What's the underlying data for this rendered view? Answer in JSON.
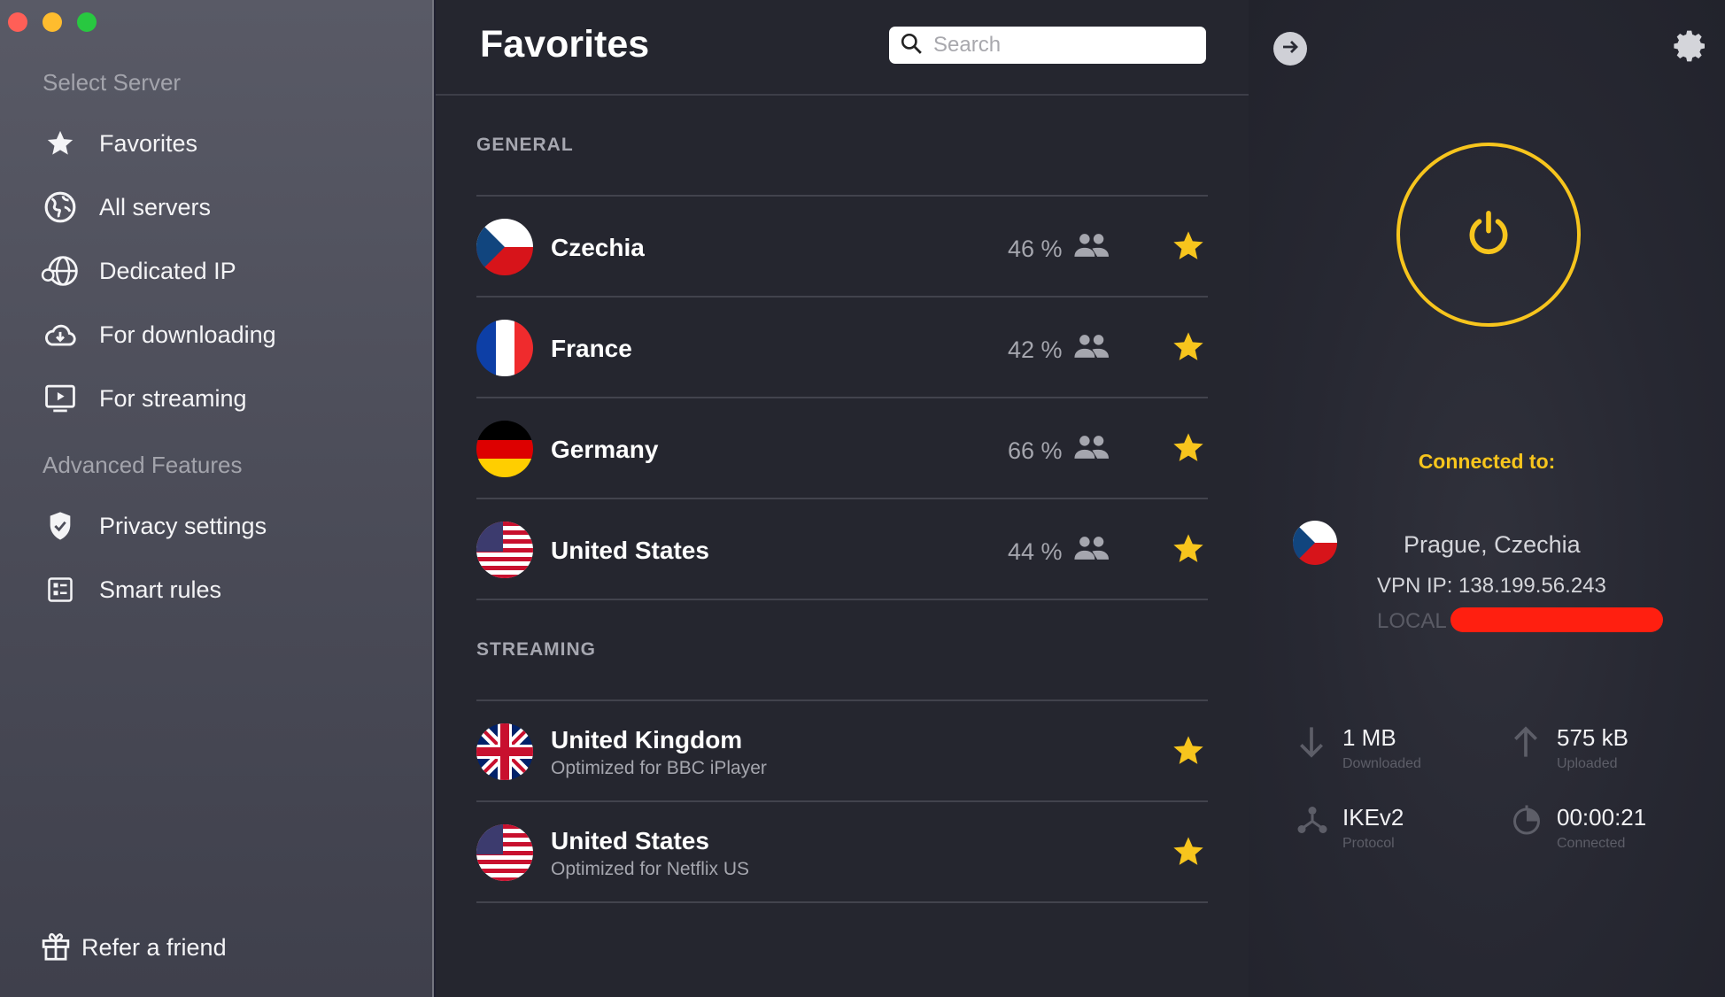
{
  "sidebar": {
    "section_select": "Select Server",
    "items": [
      {
        "label": "Favorites",
        "icon": "star-icon"
      },
      {
        "label": "All servers",
        "icon": "globe-icon"
      },
      {
        "label": "Dedicated IP",
        "icon": "dedicated-ip-globe-icon"
      },
      {
        "label": "For downloading",
        "icon": "cloud-download-icon"
      },
      {
        "label": "For streaming",
        "icon": "play-screen-icon"
      }
    ],
    "section_advanced": "Advanced Features",
    "advanced_items": [
      {
        "label": "Privacy settings",
        "icon": "shield-check-icon"
      },
      {
        "label": "Smart rules",
        "icon": "smart-rules-icon"
      }
    ],
    "refer_label": "Refer a friend"
  },
  "main": {
    "title": "Favorites",
    "search_placeholder": "Search",
    "general_label": "GENERAL",
    "general": [
      {
        "country": "Czechia",
        "load": "46 %"
      },
      {
        "country": "France",
        "load": "42 %"
      },
      {
        "country": "Germany",
        "load": "66 %"
      },
      {
        "country": "United States",
        "load": "44 %"
      }
    ],
    "streaming_label": "STREAMING",
    "streaming": [
      {
        "country": "United Kingdom",
        "subtitle": "Optimized for BBC iPlayer"
      },
      {
        "country": "United States",
        "subtitle": "Optimized for Netflix US"
      }
    ]
  },
  "connection": {
    "connected_label": "Connected to:",
    "location": "Prague, Czechia",
    "vpn_ip": "VPN IP: 138.199.56.243",
    "local_ip_label": "LOCAL I",
    "downloaded_value": "1 MB",
    "downloaded_label": "Downloaded",
    "uploaded_value": "575 kB",
    "uploaded_label": "Uploaded",
    "protocol_value": "IKEv2",
    "protocol_label": "Protocol",
    "time_value": "00:00:21",
    "time_label": "Connected"
  },
  "colors": {
    "accent": "#f7c51d",
    "star": "#f7c51d",
    "redaction": "#ff1f10"
  }
}
